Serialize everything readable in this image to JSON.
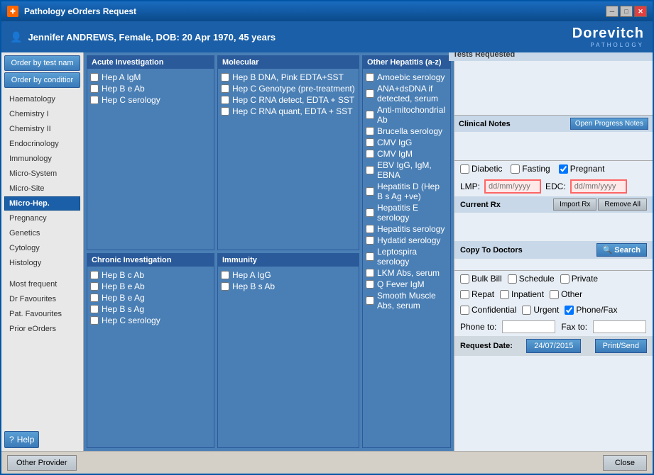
{
  "titleBar": {
    "title": "Pathology eOrders Request",
    "minimize": "─",
    "maximize": "□",
    "close": "✕"
  },
  "patient": {
    "name": "Jennifer ANDREWS, Female, DOB: 20 Apr 1970, 45 years"
  },
  "logo": {
    "main": "Dorevitch",
    "sub": "PATHOLOGY"
  },
  "sidebar": {
    "orderByTest": "Order by test nam",
    "orderByCondition": "Order by conditior",
    "items": [
      {
        "label": "Haematology",
        "active": false
      },
      {
        "label": "Chemistry I",
        "active": false
      },
      {
        "label": "Chemistry II",
        "active": false
      },
      {
        "label": "Endocrinology",
        "active": false
      },
      {
        "label": "Immunology",
        "active": false
      },
      {
        "label": "Micro-System",
        "active": false
      },
      {
        "label": "Micro-Site",
        "active": false
      },
      {
        "label": "Micro-Hep.",
        "active": true
      },
      {
        "label": "Pregnancy",
        "active": false
      },
      {
        "label": "Genetics",
        "active": false
      },
      {
        "label": "Cytology",
        "active": false
      },
      {
        "label": "Histology",
        "active": false
      }
    ],
    "bottomItems": [
      {
        "label": "Most frequent"
      },
      {
        "label": "Dr Favourites"
      },
      {
        "label": "Pat. Favourites"
      },
      {
        "label": "Prior eOrders"
      }
    ],
    "help": "Help"
  },
  "panels": {
    "acute": {
      "header": "Acute Investigation",
      "items": [
        "Hep A IgM",
        "Hep B e Ab",
        "Hep C serology"
      ]
    },
    "molecular": {
      "header": "Molecular",
      "items": [
        "Hep B DNA, Pink EDTA+SST",
        "Hep C Genotype (pre-treatment)",
        "Hep C RNA detect, EDTA + SST",
        "Hep C RNA quant, EDTA + SST"
      ]
    },
    "chronic": {
      "header": "Chronic Investigation",
      "items": [
        "Hep B c Ab",
        "Hep B e Ab",
        "Hep B e Ag",
        "Hep B s Ag",
        "Hep C serology"
      ]
    },
    "immunity": {
      "header": "Immunity",
      "items": [
        "Hep A IgG",
        "Hep B s Ab"
      ]
    },
    "otherHepatitis": {
      "header": "Other Hepatitis (a-z)",
      "items": [
        "Amoebic serology",
        "ANA+dsDNA if detected, serum",
        "Anti-mitochondrial Ab",
        "Brucella serology",
        "CMV IgG",
        "CMV IgM",
        "EBV IgG, IgM, EBNA",
        "Hepatitis D (Hep B s Ag +ve)",
        "Hepatitis E serology",
        "Hepatitis serology",
        "Hydatid serology",
        "Leptospira serology",
        "LKM Abs, serum",
        "Q Fever IgM",
        "Smooth Muscle Abs, serum"
      ]
    }
  },
  "rightPanel": {
    "testsRequested": "Tests Requested",
    "clinicalNotes": "Clinical Notes",
    "openProgressNotes": "Open Progress Notes",
    "diabetic": "Diabetic",
    "fasting": "Fasting",
    "pregnant": "Pregnant",
    "pregnantChecked": true,
    "lmp": "LMP:",
    "lmpPlaceholder": "dd/mm/yyyy",
    "edc": "EDC:",
    "edcPlaceholder": "dd/mm/yyyy",
    "currentRx": "Current Rx",
    "importRx": "Import Rx",
    "removeAll": "Remove All",
    "copyToDoctors": "Copy To Doctors",
    "search": "Search",
    "bulkBill": "Bulk Bill",
    "schedule": "Schedule",
    "private": "Private",
    "repat": "Repat",
    "inpatient": "Inpatient",
    "other": "Other",
    "confidential": "Confidential",
    "urgent": "Urgent",
    "phoneFax": "Phone/Fax",
    "phoneFaxChecked": true,
    "phoneTo": "Phone to:",
    "faxTo": "Fax to:",
    "requestDate": "Request Date:",
    "dateValue": "24/07/2015",
    "printSend": "Print/Send"
  },
  "bottomBar": {
    "otherProvider": "Other Provider",
    "close": "Close"
  }
}
